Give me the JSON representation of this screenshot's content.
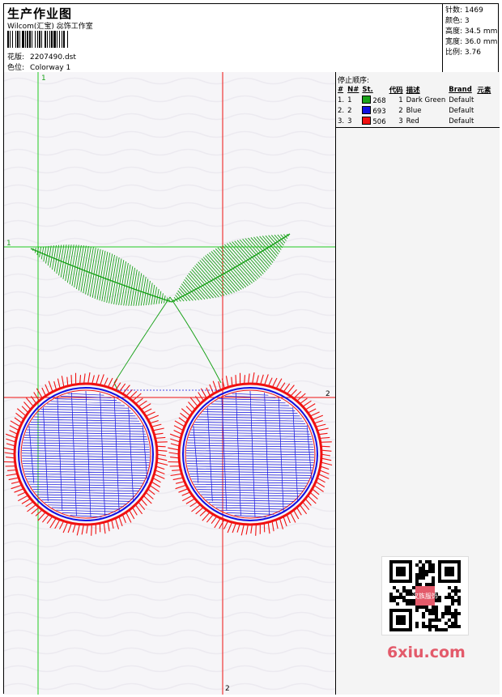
{
  "header": {
    "title": "生产作业图",
    "company": "Wilcom(汇宝) 惢饰工作室",
    "design_label": "花版:",
    "design_value": "2207490.dst",
    "colorway_label": "色位:",
    "colorway_value": "Colorway 1"
  },
  "stats": [
    {
      "label": "针数:",
      "value": "1469"
    },
    {
      "label": "颜色:",
      "value": "3"
    },
    {
      "label": "高度:",
      "value": "34.5 mm"
    },
    {
      "label": "宽度:",
      "value": "36.0 mm"
    },
    {
      "label": "比例:",
      "value": "3.76"
    }
  ],
  "stops": {
    "title": "停止顺序:",
    "columns": [
      "#",
      "N#",
      "St.",
      "代码",
      "描述",
      "Brand",
      "元素"
    ],
    "rows": [
      {
        "num": "1.",
        "n": "1",
        "color": "#1aa21a",
        "st": "268",
        "code": "1",
        "desc": "Dark Green",
        "brand": "Default"
      },
      {
        "num": "2.",
        "n": "2",
        "color": "#1010e0",
        "st": "693",
        "code": "2",
        "desc": "Blue",
        "brand": "Default"
      },
      {
        "num": "3.",
        "n": "3",
        "color": "#f01010",
        "st": "506",
        "code": "3",
        "desc": "Red",
        "brand": "Default"
      }
    ]
  },
  "axes": {
    "green_top": "1",
    "green_left": "1",
    "red_right": "2",
    "red_bottom": "2"
  },
  "colors": {
    "green": "#1aa21a",
    "blue": "#1010e0",
    "red": "#f01010",
    "guide_green": "#22cc22",
    "guide_red": "#ee1111"
  },
  "watermark": "6xiu.com",
  "qr_center_text": "汉族服饰"
}
